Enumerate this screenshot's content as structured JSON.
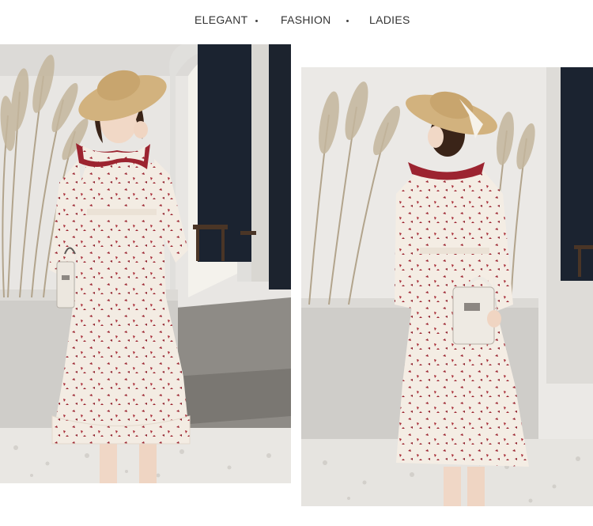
{
  "tagline": {
    "words": [
      "ELEGANT",
      "FASHION",
      "LADIES"
    ],
    "separator": "•"
  },
  "photos": [
    {
      "subject": "model front view in white floral midi dress with red ruffle collar and straw hat"
    },
    {
      "subject": "model back view in white floral midi dress holding white handbag"
    }
  ],
  "colors": {
    "dress": "#f3ece3",
    "print": "#9c2430",
    "hat": "#d2b27e",
    "wall": "#e6e4e1",
    "pampas": "#b9ab93"
  }
}
